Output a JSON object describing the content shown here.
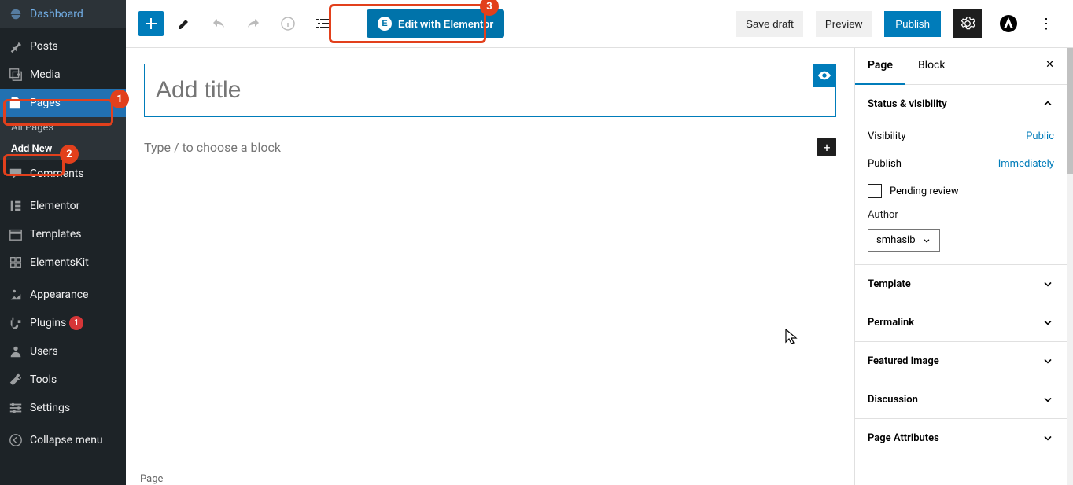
{
  "sidebar": {
    "items": [
      {
        "label": "Dashboard",
        "icon": "dashboard-icon"
      },
      {
        "label": "Posts",
        "icon": "pin-icon"
      },
      {
        "label": "Media",
        "icon": "media-icon"
      },
      {
        "label": "Pages",
        "icon": "pages-icon",
        "active": true
      },
      {
        "label": "Comments",
        "icon": "comments-icon"
      },
      {
        "label": "Elementor",
        "icon": "elementor-icon"
      },
      {
        "label": "Templates",
        "icon": "templates-icon"
      },
      {
        "label": "ElementsKit",
        "icon": "elementskit-icon"
      },
      {
        "label": "Appearance",
        "icon": "appearance-icon"
      },
      {
        "label": "Plugins",
        "icon": "plugins-icon",
        "badge": "1"
      },
      {
        "label": "Users",
        "icon": "users-icon"
      },
      {
        "label": "Tools",
        "icon": "tools-icon"
      },
      {
        "label": "Settings",
        "icon": "settings-icon"
      },
      {
        "label": "Collapse menu",
        "icon": "collapse-icon"
      }
    ],
    "submenu": {
      "all_pages": "All Pages",
      "add_new": "Add New"
    }
  },
  "callouts": {
    "one": "1",
    "two": "2",
    "three": "3"
  },
  "topbar": {
    "elementor_label": "Edit with Elementor",
    "save_draft": "Save draft",
    "preview": "Preview",
    "publish": "Publish"
  },
  "editor": {
    "title_placeholder": "Add title",
    "block_prompt": "Type / to choose a block",
    "footer": "Page"
  },
  "inspector": {
    "tabs": {
      "page": "Page",
      "block": "Block"
    },
    "panel_status": "Status & visibility",
    "visibility_label": "Visibility",
    "visibility_value": "Public",
    "publish_label": "Publish",
    "publish_value": "Immediately",
    "pending_review": "Pending review",
    "author_label": "Author",
    "author_value": "smhasib",
    "panel_template": "Template",
    "panel_permalink": "Permalink",
    "panel_featured": "Featured image",
    "panel_discussion": "Discussion",
    "panel_attributes": "Page Attributes"
  }
}
